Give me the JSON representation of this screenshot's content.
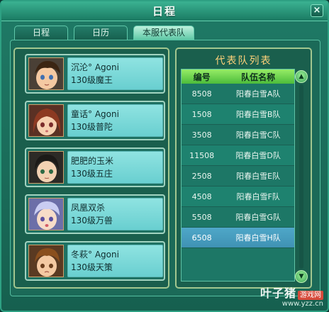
{
  "window": {
    "title": "日程",
    "close_label": "×"
  },
  "tabs": [
    {
      "label": "日程"
    },
    {
      "label": "日历"
    },
    {
      "label": "本服代表队"
    }
  ],
  "members": [
    {
      "name": "沉沦° Agoni",
      "desc": "130级魔王"
    },
    {
      "name": "童话° Agoni",
      "desc": "130级普陀"
    },
    {
      "name": "肥肥的玉米",
      "desc": "130级五庄"
    },
    {
      "name": "凤凰双杀",
      "desc": "130级万兽"
    },
    {
      "name": "冬萩° Agoni",
      "desc": "130级天策"
    }
  ],
  "team_list": {
    "title": "代表队列表",
    "columns": [
      "编号",
      "队伍名称"
    ],
    "rows": [
      {
        "id": "8508",
        "name": "阳春白雪A队"
      },
      {
        "id": "1508",
        "name": "阳春白雪B队"
      },
      {
        "id": "3508",
        "name": "阳春白雪C队"
      },
      {
        "id": "11508",
        "name": "阳春白雪D队"
      },
      {
        "id": "2508",
        "name": "阳春白雪E队"
      },
      {
        "id": "4508",
        "name": "阳春白雪F队"
      },
      {
        "id": "5508",
        "name": "阳春白雪G队"
      },
      {
        "id": "6508",
        "name": "阳春白雪H队"
      }
    ],
    "selected_id": "6508"
  },
  "watermark": {
    "brand": "叶子猪",
    "tag": "游戏网",
    "url": "www.yzz.cn"
  }
}
